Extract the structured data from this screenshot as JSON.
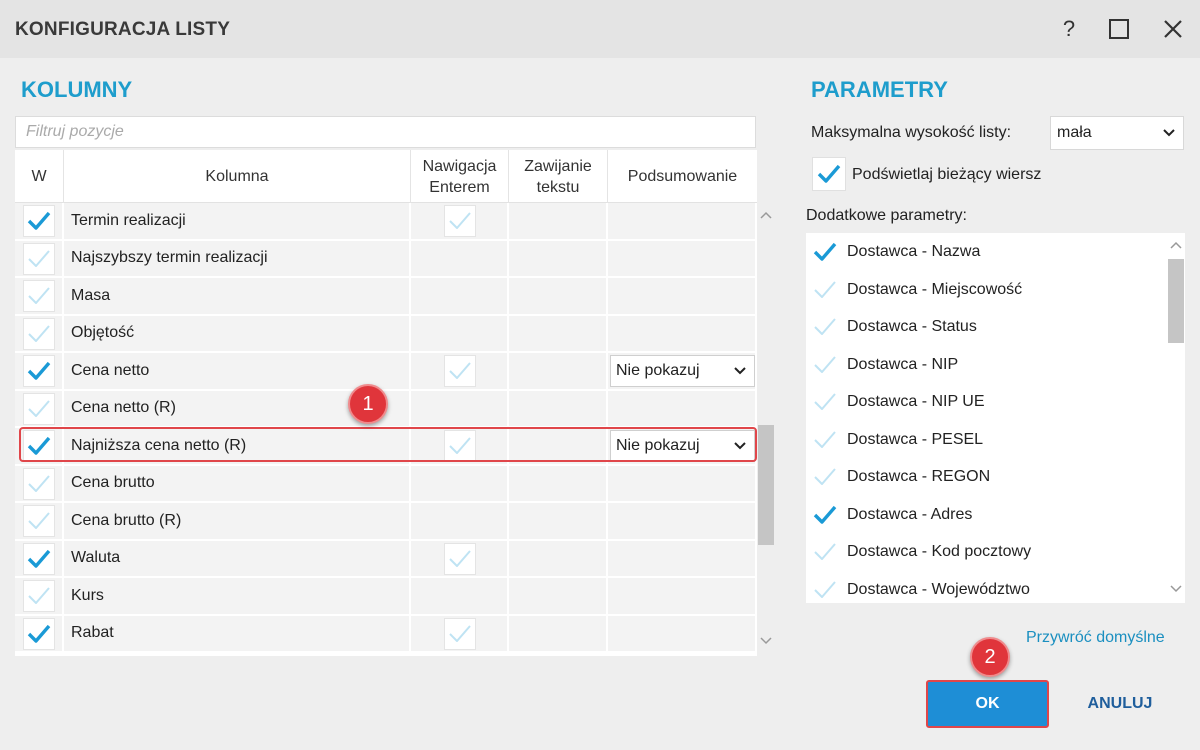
{
  "window": {
    "title": "KONFIGURACJA LISTY",
    "help": "?"
  },
  "left": {
    "section_title": "KOLUMNY",
    "filter_placeholder": "Filtruj pozycje",
    "headers": {
      "w": "W",
      "kolumna": "Kolumna",
      "nawigacja": "Nawigacja Enterem",
      "zawijanie": "Zawijanie tekstu",
      "podsumowanie": "Podsumowanie"
    },
    "rows": [
      {
        "visible": true,
        "name": "Termin realizacji",
        "enter": true,
        "summary": ""
      },
      {
        "visible": false,
        "name": "Najszybszy termin realizacji",
        "enter": null,
        "summary": ""
      },
      {
        "visible": false,
        "name": "Masa",
        "enter": null,
        "summary": ""
      },
      {
        "visible": false,
        "name": "Objętość",
        "enter": null,
        "summary": ""
      },
      {
        "visible": true,
        "name": "Cena netto",
        "enter": true,
        "summary": "Nie pokazuj"
      },
      {
        "visible": false,
        "name": "Cena netto (R)",
        "enter": null,
        "summary": ""
      },
      {
        "visible": true,
        "name": "Najniższa cena netto (R)",
        "enter": true,
        "summary": "Nie pokazuj"
      },
      {
        "visible": false,
        "name": "Cena brutto",
        "enter": null,
        "summary": ""
      },
      {
        "visible": false,
        "name": "Cena brutto (R)",
        "enter": null,
        "summary": ""
      },
      {
        "visible": true,
        "name": "Waluta",
        "enter": true,
        "summary": ""
      },
      {
        "visible": false,
        "name": "Kurs",
        "enter": null,
        "summary": ""
      },
      {
        "visible": true,
        "name": "Rabat",
        "enter": true,
        "summary": ""
      }
    ]
  },
  "right": {
    "section_title": "PARAMETRY",
    "max_height_label": "Maksymalna wysokość listy:",
    "max_height_value": "mała",
    "highlight_label": "Podświetlaj bieżący wiersz",
    "highlight_checked": true,
    "extra_label": "Dodatkowe parametry:",
    "params": [
      {
        "label": "Dostawca - Nazwa",
        "checked": true
      },
      {
        "label": "Dostawca - Miejscowość",
        "checked": false
      },
      {
        "label": "Dostawca - Status",
        "checked": false
      },
      {
        "label": "Dostawca - NIP",
        "checked": false
      },
      {
        "label": "Dostawca - NIP UE",
        "checked": false
      },
      {
        "label": "Dostawca - PESEL",
        "checked": false
      },
      {
        "label": "Dostawca - REGON",
        "checked": false
      },
      {
        "label": "Dostawca - Adres",
        "checked": true
      },
      {
        "label": "Dostawca - Kod pocztowy",
        "checked": false
      },
      {
        "label": "Dostawca - Województwo",
        "checked": false
      }
    ],
    "restore_link": "Przywróć domyślne"
  },
  "buttons": {
    "ok": "OK",
    "cancel": "ANULUJ"
  },
  "annotations": {
    "badge1": "1",
    "badge2": "2"
  },
  "colors": {
    "accent": "#1e9dcc",
    "check_on": "#1a9ad6",
    "check_off": "#bfe3f3",
    "ok_bg": "#1e8ed6",
    "callout": "#e0353b"
  }
}
